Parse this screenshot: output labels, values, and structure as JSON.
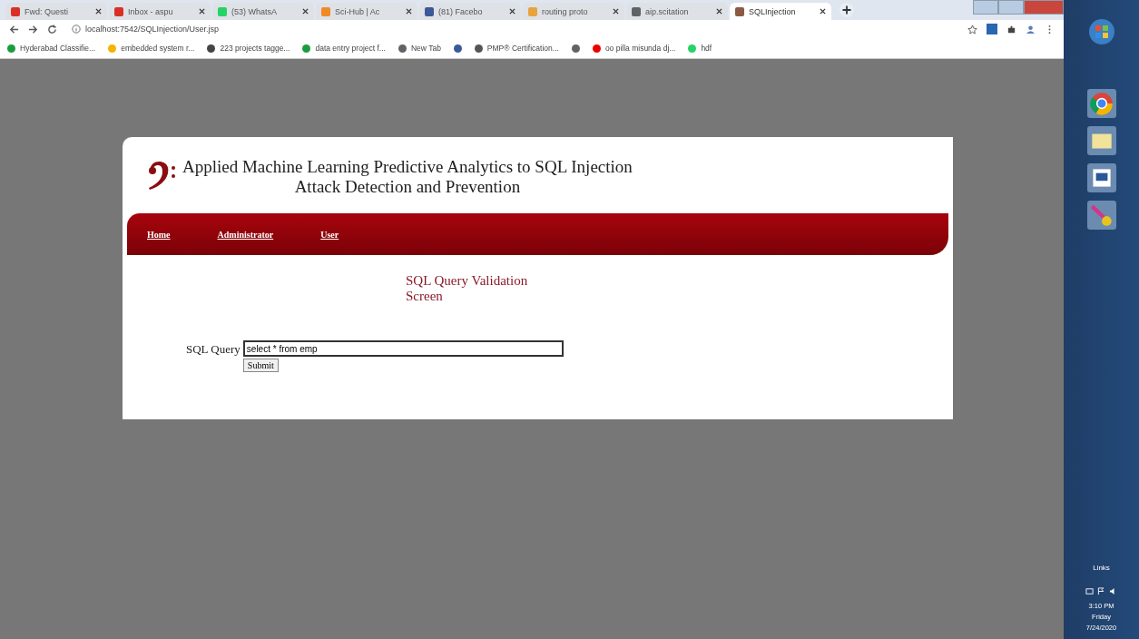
{
  "browser": {
    "tabs": [
      {
        "title": "Fwd: Questi",
        "kind": "mail",
        "selected": false
      },
      {
        "title": "Inbox - aspu",
        "kind": "mail",
        "selected": false
      },
      {
        "title": "(53) WhatsA",
        "kind": "chat",
        "selected": false
      },
      {
        "title": "Sci-Hub | Ac",
        "kind": "hub",
        "selected": false
      },
      {
        "title": "(81) Facebo",
        "kind": "social",
        "selected": false
      },
      {
        "title": "routing proto",
        "kind": "search",
        "selected": false
      },
      {
        "title": "aip.scitation",
        "kind": "globe",
        "selected": false
      },
      {
        "title": "SQLInjection",
        "kind": "page",
        "selected": true
      }
    ],
    "url": "localhost:7542/SQLInjection/User.jsp",
    "bookmarks": [
      {
        "title": "Hyderabad Classifie...",
        "kind": "q"
      },
      {
        "title": "embedded system r...",
        "kind": "drive"
      },
      {
        "title": "223 projects tagge...",
        "kind": "doc"
      },
      {
        "title": "data entry project f...",
        "kind": "q"
      },
      {
        "title": "New Tab",
        "kind": "globe"
      },
      {
        "kind": "social"
      },
      {
        "title": "PMP® Certification...",
        "kind": "pin"
      },
      {
        "kind": "globe"
      },
      {
        "title": "oo pilla misunda dj...",
        "kind": "video"
      },
      {
        "title": "hdf",
        "kind": "chat"
      }
    ]
  },
  "site": {
    "title_line_1": "Applied Machine Learning Predictive Analytics to SQL Injection",
    "title_line_2": "Attack Detection and Prevention",
    "nav": [
      "Home",
      "Administrator",
      "User"
    ],
    "heading_line_1": "SQL Query Validation",
    "heading_line_2": "Screen",
    "query_label": "SQL Query",
    "query_value": "select * from emp",
    "submit": "Submit"
  },
  "taskbar": {
    "links": "Links",
    "time": "3:10 PM",
    "day": "Friday",
    "date": "7/24/2020"
  }
}
